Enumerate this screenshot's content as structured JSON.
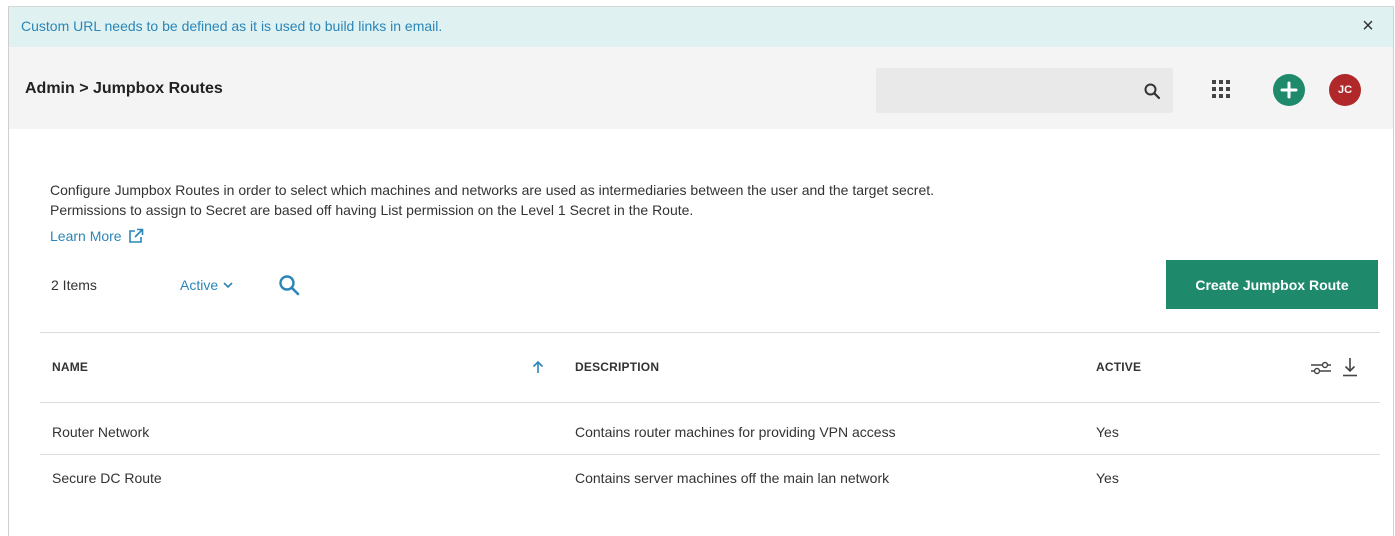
{
  "banner": {
    "message": "Custom URL needs to be defined as it is used to build links in email.",
    "close_glyph": "×"
  },
  "header": {
    "breadcrumb": "Admin > Jumpbox Routes",
    "search": {
      "placeholder": "",
      "value": ""
    },
    "avatar_initials": "JC"
  },
  "description": {
    "line1": "Configure Jumpbox Routes in order to select which machines and networks are used as intermediaries between the user and the target secret.",
    "line2": "Permissions to assign to Secret are based off having List permission on the Level 1 Secret in the Route.",
    "learn_more": "Learn More"
  },
  "toolbar": {
    "item_count": "2 Items",
    "filter_label": "Active",
    "create_button": "Create Jumpbox Route"
  },
  "table": {
    "columns": {
      "name": "NAME",
      "description": "DESCRIPTION",
      "active": "ACTIVE"
    },
    "rows": [
      {
        "name": "Router Network",
        "description": "Contains router machines for providing VPN access",
        "active": "Yes"
      },
      {
        "name": "Secure DC Route",
        "description": "Contains server machines off the main lan network",
        "active": "Yes"
      }
    ]
  },
  "colors": {
    "accent_green": "#1e8a6b",
    "link_blue": "#2b86b8",
    "banner_bg": "#dff1f1",
    "avatar_red": "#b0282a"
  },
  "icons": {
    "banner": "close-icon",
    "header": [
      "search-icon",
      "apps-grid-icon",
      "add-icon",
      "avatar"
    ],
    "learn_more": "external-link-icon",
    "filter": [
      "chevron-down-icon",
      "search-icon"
    ],
    "table": [
      "sort-ascending-icon",
      "column-settings-icon",
      "export-icon"
    ]
  }
}
